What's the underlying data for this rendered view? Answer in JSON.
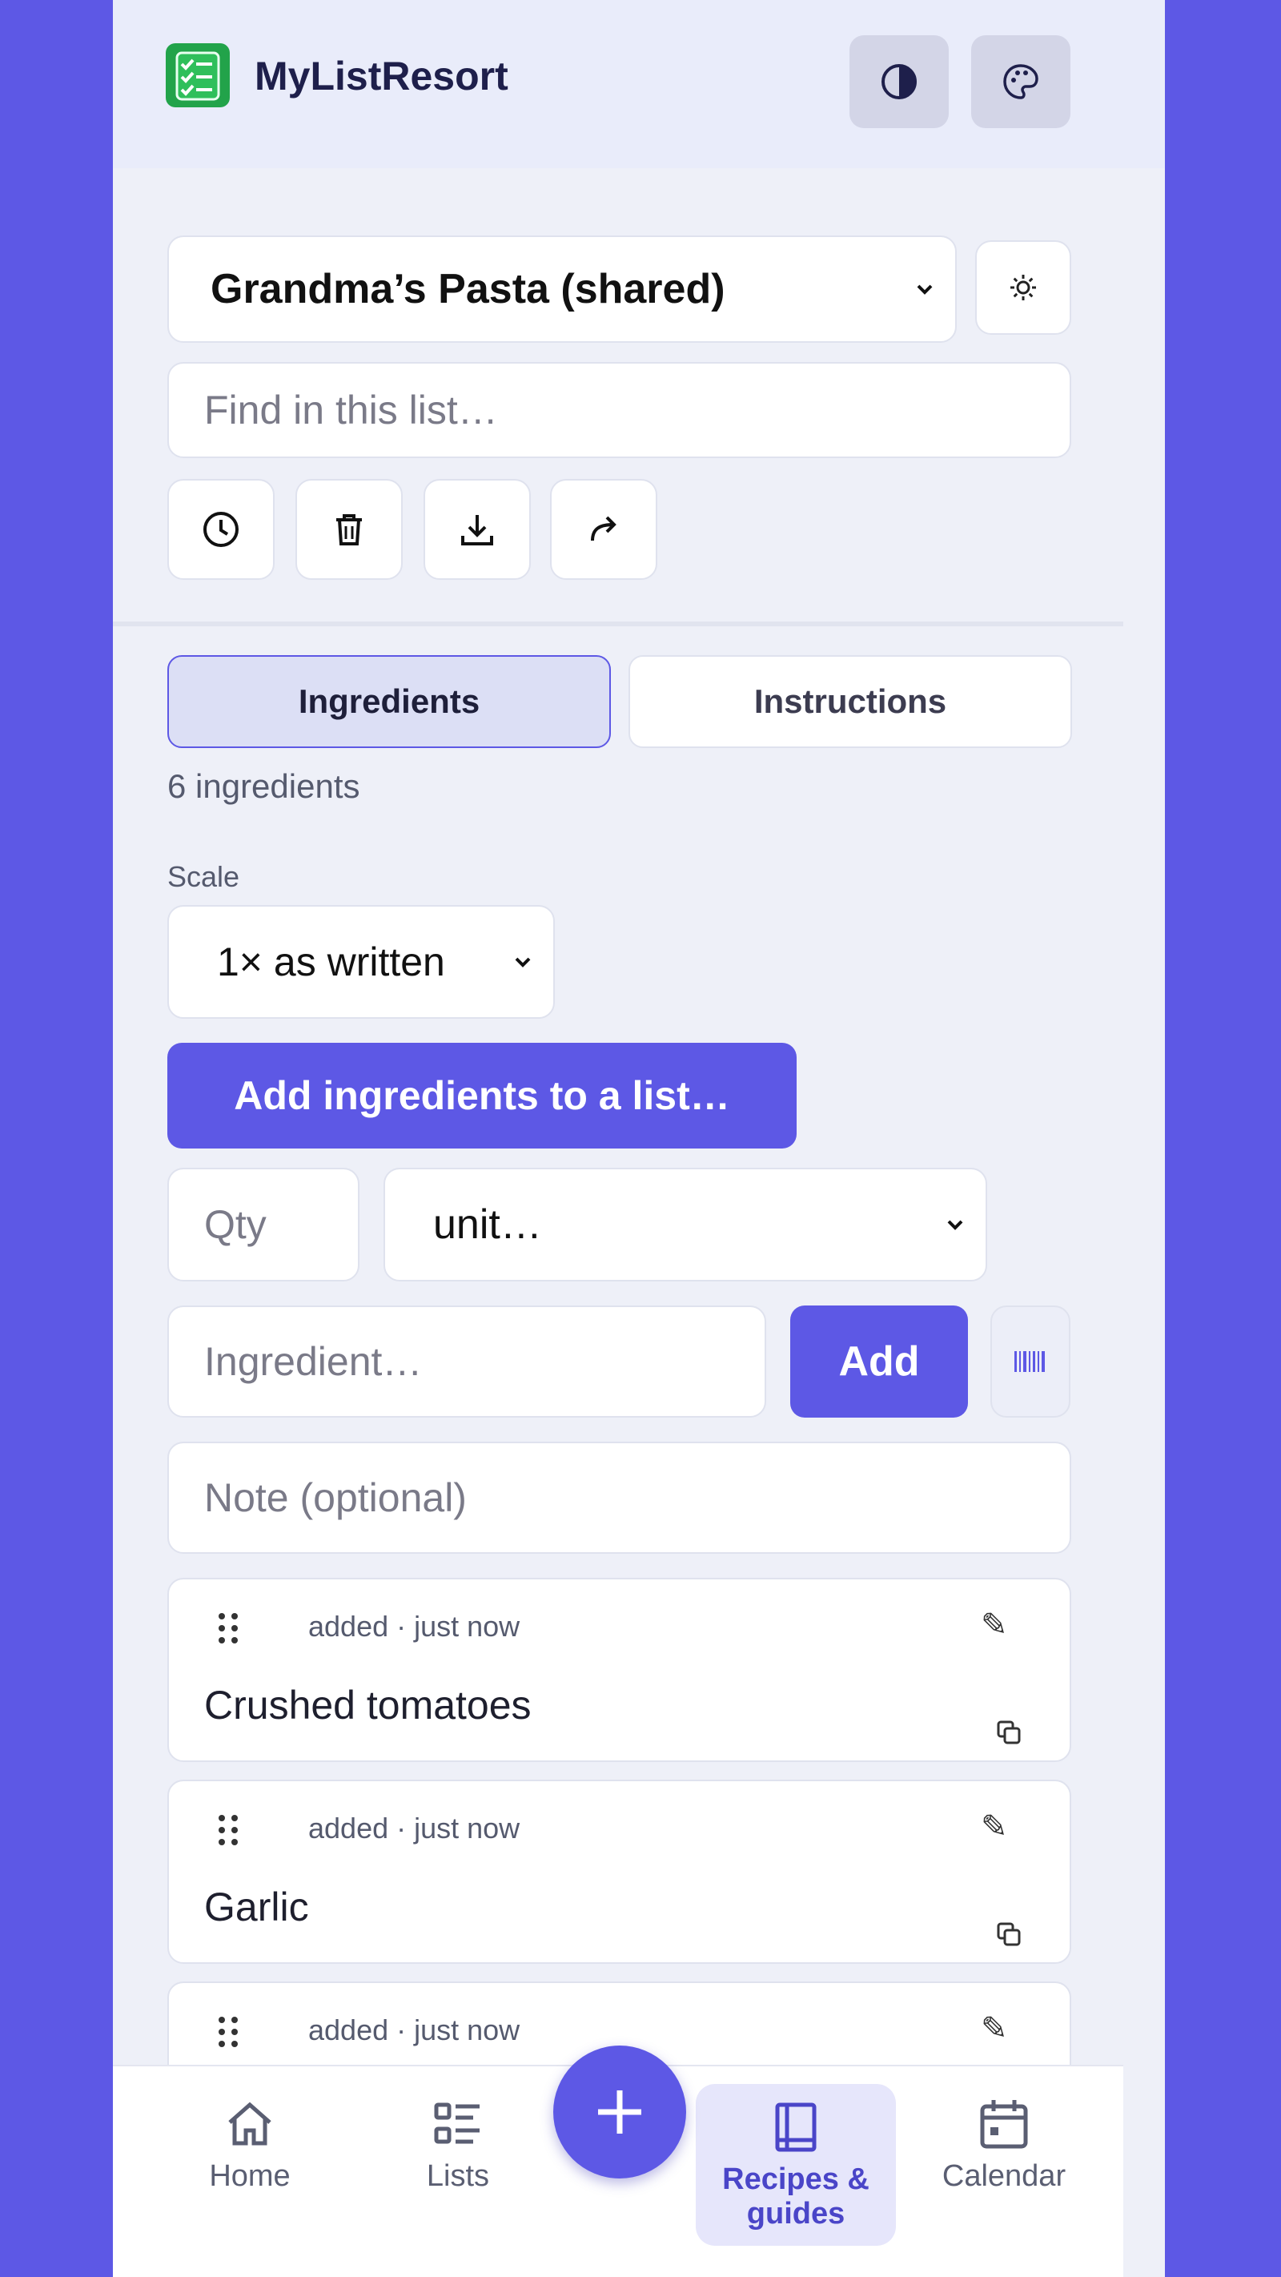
{
  "app": {
    "brand": "MyListResort"
  },
  "list_selector": {
    "value": "Grandma’s Pasta (shared)"
  },
  "search": {
    "placeholder": "Find in this list…"
  },
  "tabs": [
    {
      "label": "Ingredients",
      "active": true
    },
    {
      "label": "Instructions",
      "active": false
    }
  ],
  "ingredient_count": "6 ingredients",
  "scale": {
    "label": "Scale",
    "value": "1× as written"
  },
  "add_to_list_label": "Add ingredients to a list…",
  "form": {
    "qty_placeholder": "Qty",
    "unit_value": "unit…",
    "ingredient_placeholder": "Ingredient…",
    "add_label": "Add",
    "note_placeholder": "Note (optional)"
  },
  "items": [
    {
      "meta": "added · just now",
      "name": "Crushed tomatoes"
    },
    {
      "meta": "added · just now",
      "name": "Garlic"
    },
    {
      "meta": "added · just now",
      "name": ""
    }
  ],
  "nav": [
    {
      "label": "Home",
      "icon": "home-icon"
    },
    {
      "label": "Lists",
      "icon": "list-icon"
    },
    {
      "label": "Recipes & guides",
      "icon": "book-icon",
      "active": true
    },
    {
      "label": "Calendar",
      "icon": "calendar-icon"
    }
  ],
  "colors": {
    "accent": "#5d58e5",
    "brand_green": "#22a34a",
    "page_bg": "#eef0f8"
  }
}
